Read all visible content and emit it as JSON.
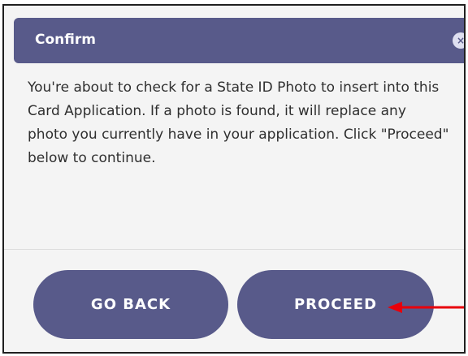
{
  "dialog": {
    "title": "Confirm",
    "close_icon": "close-circle-icon",
    "close_glyph": "×",
    "message": "You're about to check for a State ID Photo to insert into this Card Application. If a photo is found, it will replace any photo you currently have in your application. Click \"Proceed\" below to continue.",
    "buttons": {
      "go_back": "GO BACK",
      "proceed": "PROCEED"
    },
    "annotation": {
      "icon": "red-arrow-icon",
      "color": "#e8000b"
    }
  },
  "colors": {
    "accent": "#585a8a",
    "background": "#f4f4f4"
  }
}
